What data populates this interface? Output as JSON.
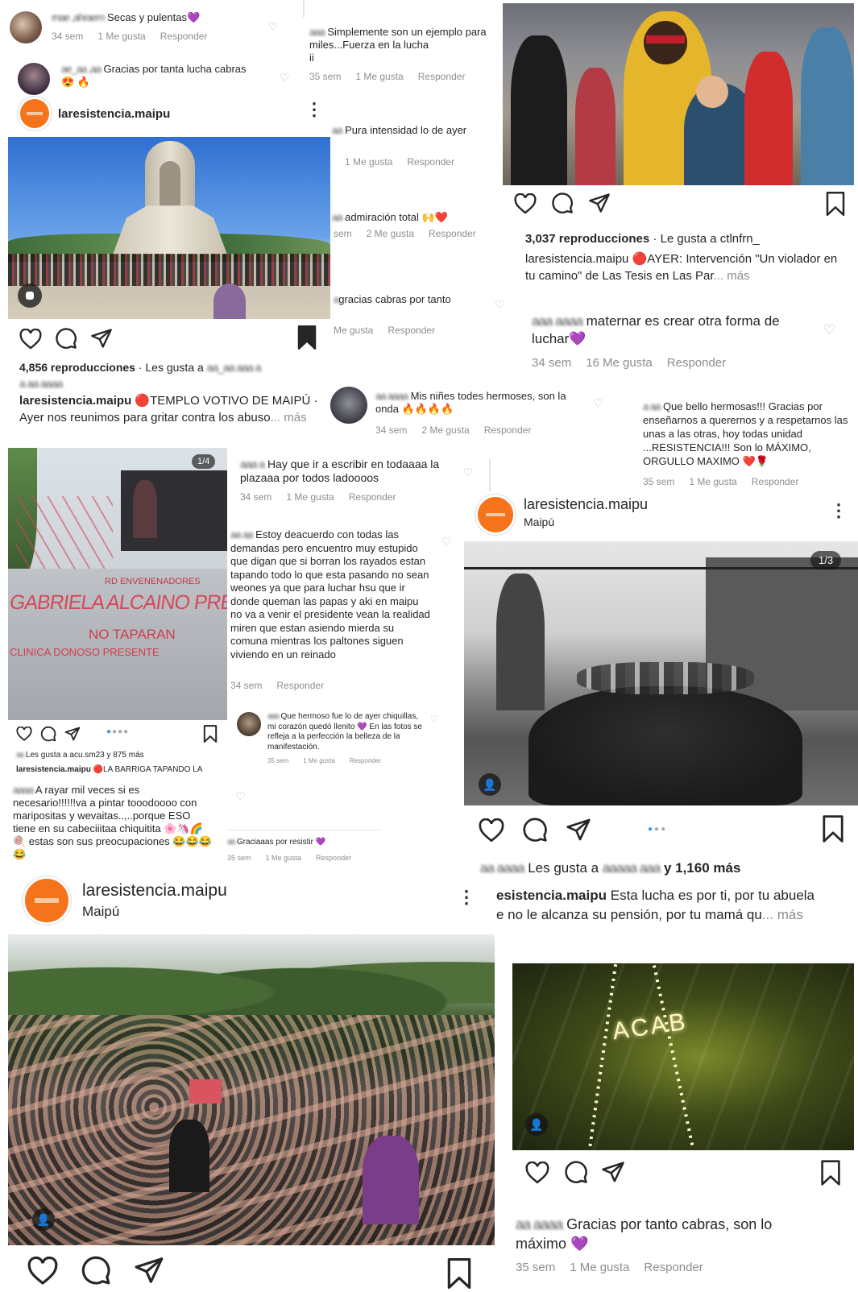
{
  "account": {
    "handle": "laresistencia.maipu",
    "location": "Maipú"
  },
  "icons": {
    "like": "heart-outline-icon",
    "comment": "comment-bubble-icon",
    "share": "paper-plane-icon",
    "save": "bookmark-icon",
    "more": "three-dots-vertical-icon",
    "tagged": "person-icon"
  },
  "colors": {
    "brand_orange": "#f4731b",
    "muted_text": "#8e8e8e",
    "blue_dot": "#3897f0"
  },
  "comments": [
    {
      "text": "Secas y pulentas💜",
      "age": "34 sem",
      "likes": "1 Me gusta",
      "reply": "Responder"
    },
    {
      "text": "Gracias por tanta lucha cabras 😍 🔥"
    },
    {
      "text": "Simplemente son un ejemplo para miles...Fuerza en la lucha",
      "age": "35 sem",
      "likes": "1 Me gusta",
      "reply": "Responder"
    },
    {
      "text": "Pura intensidad lo de ayer",
      "likes": "1 Me gusta",
      "reply": "Responder"
    },
    {
      "text": "admiración total 🙌❤️",
      "age": "sem",
      "likes": "2 Me gusta",
      "reply": "Responder"
    },
    {
      "text": "gracias cabras por tanto",
      "likes": "Me gusta",
      "reply": "Responder"
    },
    {
      "text": "maternar es crear otra forma de luchar💜",
      "age": "34 sem",
      "likes": "16 Me gusta",
      "reply": "Responder"
    },
    {
      "text": "Mis niñes todes hermoses, son la onda 🔥🔥🔥🔥",
      "age": "34 sem",
      "likes": "2 Me gusta",
      "reply": "Responder"
    },
    {
      "text": "Que bello hermosas!!! Gracias por enseñarnos a querernos y a respetarnos las unas a las otras, hoy todas unidad ...RESISTENCIA!!! Son lo MÁXIMO, ORGULLO MAXIMO ❤️🌹",
      "age": "35 sem",
      "likes": "1 Me gusta",
      "reply": "Responder"
    },
    {
      "text": "Hay que ir a escribir en todaaaa la plazaaa por todos ladoooos",
      "age": "34 sem",
      "likes": "1 Me gusta",
      "reply": "Responder"
    },
    {
      "text": "Estoy deacuerdo con todas las demandas pero encuentro muy estupido que digan que si borran los rayados estan tapando todo lo que esta pasando no sean weones ya que para luchar hsu que ir donde queman las papas y aki en maipu no va a venir el presidente vean la realidad miren que estan asiendo mierda su comuna mientras los paltones siguen viviendo en un reinado",
      "age": "34 sem",
      "reply": "Responder"
    },
    {
      "text": "Que hermoso fue lo de ayer chiquillas, mi corazón quedó llenito 💜 En las fotos se refleja a la perfección la belleza de la manifestación.",
      "age": "35 sem",
      "likes": "1 Me gusta",
      "reply": "Responder"
    },
    {
      "text": "A rayar mil veces si es necesario!!!!!!va a pintar tooodoooo con maripositas y wevaitas..,..porque ESO tiene en su cabeciiitaa chiquitita 🌸🦄🌈🍭 estas son sus preocupaciones 😂😂😂😂"
    },
    {
      "text": "Graciaaas por resistir 💜",
      "age": "35 sem",
      "likes": "1 Me gusta",
      "reply": "Responder"
    },
    {
      "text": "Gracias por tanto cabras, son lo máximo 💜",
      "age": "35 sem",
      "likes": "1 Me gusta",
      "reply": "Responder"
    }
  ],
  "posts": {
    "templo": {
      "views": "4,856 reproducciones",
      "liked_by": "· Les gusta a",
      "caption": "🔴TEMPLO VOTIVO DE MAIPÚ · Ayer nos reunimos para gritar contra los abuso",
      "more": "... más"
    },
    "violador": {
      "views": "3,037 reproducciones",
      "liked_by": "· Le gusta a ctlnfrn_",
      "caption": "🔴AYER: Intervención \"Un violador en tu camino\" de Las Tesis en Las Par",
      "more": "... más"
    },
    "barriga": {
      "counter": "1/4",
      "liked_by": "Les gusta a acu.sm23 y 875 más",
      "caption": "🔴LA BARRIGA TAPANDO LA",
      "mural_lines": [
        "GABRIELA ALCAINO PRESA",
        "NO TAPARAN",
        "CLINICA DONOSO PRESENTE",
        "RD ENVENENADORES"
      ]
    },
    "abuela": {
      "counter": "1/3",
      "liked_by_prefix": "Les gusta a",
      "liked_by_suffix": "y 1,160 más",
      "caption_handle": "esistencia.maipu",
      "caption": "Esta lucha es por ti, por tu abuela",
      "caption2": "e no le alcanza su pensión, por tu mamá qu",
      "more": "... más"
    },
    "acab": {
      "graffiti": "ACAB"
    }
  }
}
